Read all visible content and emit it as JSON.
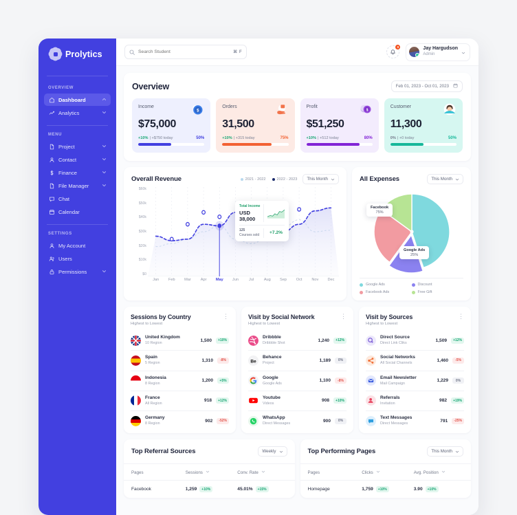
{
  "brand": {
    "name": "Prolytics",
    "logo_icon": "gear-logo-icon",
    "accent": "#4240e0"
  },
  "sidebar": {
    "sections": [
      {
        "label": "OVERVIEW",
        "items": [
          {
            "label": "Dashboard",
            "icon": "home-icon",
            "chevron": "chevron-up-icon",
            "active": true
          },
          {
            "label": "Analytics",
            "icon": "analytics-icon",
            "chevron": "chevron-down-icon",
            "active": false
          }
        ]
      },
      {
        "label": "MENU",
        "items": [
          {
            "label": "Project",
            "icon": "file-icon",
            "chevron": "chevron-down-icon",
            "active": false
          },
          {
            "label": "Contact",
            "icon": "user-icon",
            "chevron": "chevron-down-icon",
            "active": false
          },
          {
            "label": "Finance",
            "icon": "dollar-icon",
            "chevron": "chevron-down-icon",
            "active": false
          },
          {
            "label": "File Manager",
            "icon": "file-icon",
            "chevron": "chevron-down-icon",
            "active": false
          },
          {
            "label": "Chat",
            "icon": "chat-icon",
            "chevron": "",
            "active": false
          },
          {
            "label": "Calendar",
            "icon": "calendar-icon",
            "chevron": "",
            "active": false
          }
        ]
      },
      {
        "label": "SETTINGS",
        "items": [
          {
            "label": "My Account",
            "icon": "user-icon",
            "chevron": "",
            "active": false
          },
          {
            "label": "Users",
            "icon": "users-icon",
            "chevron": "",
            "active": false
          },
          {
            "label": "Permissions",
            "icon": "lock-icon",
            "chevron": "chevron-down-icon",
            "active": false
          }
        ]
      }
    ]
  },
  "topbar": {
    "search_placeholder": "Search Student",
    "search_value": "",
    "search_icon": "search-icon",
    "shortcut": "⌘ F",
    "bell_icon": "bell-icon",
    "notification_count": "0",
    "user_name": "Jay Hargudson",
    "user_role": "Admin",
    "user_chevron": "chevron-down-icon"
  },
  "overview": {
    "title": "Overview",
    "date_range": "Feb 01, 2023 - Oct 01, 2023",
    "calendar_icon": "calendar-icon",
    "kpis": [
      {
        "label": "Income",
        "value": "$75,000",
        "delta": "+10%",
        "sub": "| +$750 today",
        "pct": "50%",
        "fill": 50,
        "bg": "#eef0fe",
        "accent": "#4240e0",
        "delta_color": "#17a673",
        "icon": "coin-dollar-icon"
      },
      {
        "label": "Orders",
        "value": "31,500",
        "delta": "+10%",
        "sub": "| +315 today",
        "pct": "75%",
        "fill": 75,
        "bg": "#fdeae4",
        "accent": "#f26132",
        "delta_color": "#17a673",
        "icon": "hand-package-icon"
      },
      {
        "label": "Profit",
        "value": "$51,250",
        "delta": "+10%",
        "sub": "| +512 today",
        "pct": "80%",
        "fill": 80,
        "bg": "#f3ecfd",
        "accent": "#8224d6",
        "delta_color": "#17a673",
        "icon": "coin-stack-icon"
      },
      {
        "label": "Customer",
        "value": "11,300",
        "delta": "0%",
        "sub": "| +0 today",
        "pct": "50%",
        "fill": 50,
        "bg": "#d6f7f1",
        "accent": "#17b89a",
        "delta_color": "#74798a",
        "icon": "person-avatar-icon"
      }
    ]
  },
  "chart_data": [
    {
      "type": "line",
      "title": "Overall Revenue",
      "xlabel": "",
      "ylabel": "",
      "ylim": [
        0,
        60000
      ],
      "ytick_labels": [
        "$60k",
        "$50k",
        "$40k",
        "$30k",
        "$20k",
        "$10k",
        "$0"
      ],
      "categories": [
        "Jan",
        "Feb",
        "Mar",
        "Apr",
        "May",
        "Jun",
        "Jul",
        "Aug",
        "Sep",
        "Oct",
        "Nov",
        "Dec"
      ],
      "highlight_category": "May",
      "grid": true,
      "legend_position": "top-right",
      "period_selector": "This Month",
      "series": [
        {
          "name": "2021 - 2022",
          "color": "#b8d9ef",
          "values": [
            20000,
            22000,
            25000,
            30000,
            34000,
            25000,
            22000,
            26000,
            33000,
            38000,
            30000,
            31000
          ]
        },
        {
          "name": "2022 - 2023",
          "color": "#4240e0",
          "values": [
            27000,
            24000,
            25000,
            35000,
            34000,
            43000,
            44000,
            38000,
            30000,
            35000,
            44000,
            46000
          ]
        }
      ],
      "markers": [
        {
          "x": "Feb",
          "y": 25000
        },
        {
          "x": "Mar",
          "y": 35000
        },
        {
          "x": "Apr",
          "y": 43000
        },
        {
          "x": "May",
          "y": 40000
        },
        {
          "x": "Sep",
          "y": 44000
        },
        {
          "x": "Oct",
          "y": 45000
        }
      ],
      "tooltip": {
        "caption": "Total Income",
        "value": "USD 38,000",
        "count": "125",
        "count_label": "Courses sold",
        "change": "+7.2%"
      }
    },
    {
      "type": "pie",
      "title": "All Expenses",
      "period_selector": "This Month",
      "labels": [
        "Google Ads",
        "Discount",
        "Facebook Ads",
        "Free Gift"
      ],
      "values": [
        45,
        15,
        25,
        15
      ],
      "colors": [
        "#7fd9de",
        "#8b82f0",
        "#f29ba1",
        "#b7e494"
      ],
      "callouts": [
        {
          "label": "Facebook",
          "value": "75%"
        },
        {
          "label": "Google Ads",
          "value": "25%"
        }
      ],
      "legend_position": "bottom"
    }
  ],
  "panels": [
    {
      "title": "Sessions by Country",
      "subtitle": "Highest to Lowest",
      "menu_icon": "kebab-menu-icon",
      "rows": [
        {
          "name": "United Kingdom",
          "sub": "10 Region",
          "value": "1,500",
          "badge": "+10%",
          "trend": "up",
          "icon": "flag-uk-icon"
        },
        {
          "name": "Spain",
          "sub": "5 Region",
          "value": "1,310",
          "badge": "-8%",
          "trend": "down",
          "icon": "flag-spain-icon"
        },
        {
          "name": "Indonesia",
          "sub": "8 Region",
          "value": "1,200",
          "badge": "+5%",
          "trend": "up",
          "icon": "flag-indonesia-icon"
        },
        {
          "name": "France",
          "sub": "All Region",
          "value": "918",
          "badge": "+12%",
          "trend": "up",
          "icon": "flag-france-icon"
        },
        {
          "name": "Germany",
          "sub": "8 Region",
          "value": "902",
          "badge": "-52%",
          "trend": "down",
          "icon": "flag-germany-icon"
        }
      ]
    },
    {
      "title": "Visit by Social Network",
      "subtitle": "Highest to Lowest",
      "menu_icon": "kebab-menu-icon",
      "rows": [
        {
          "name": "Dribbble",
          "sub": "Dribbble Shot",
          "value": "1,240",
          "badge": "+12%",
          "trend": "up",
          "icon": "dribbble-icon"
        },
        {
          "name": "Behance",
          "sub": "Project",
          "value": "1,189",
          "badge": "0%",
          "trend": "zero",
          "icon": "behance-icon"
        },
        {
          "name": "Google",
          "sub": "Google Ads",
          "value": "1,100",
          "badge": "-8%",
          "trend": "down",
          "icon": "google-icon"
        },
        {
          "name": "Youtube",
          "sub": "Videos",
          "value": "908",
          "badge": "+10%",
          "trend": "up",
          "icon": "youtube-icon"
        },
        {
          "name": "WhatsApp",
          "sub": "Direct Messages",
          "value": "900",
          "badge": "0%",
          "trend": "zero",
          "icon": "whatsapp-icon"
        }
      ]
    },
    {
      "title": "Visit by Sources",
      "subtitle": "Highest to Lowest",
      "menu_icon": "kebab-menu-icon",
      "rows": [
        {
          "name": "Direct Source",
          "sub": "Direct Link Cliks",
          "value": "1,509",
          "badge": "+12%",
          "trend": "up",
          "icon": "cursor-click-icon"
        },
        {
          "name": "Social Networks",
          "sub": "All Social Channels",
          "value": "1,460",
          "badge": "-5%",
          "trend": "down",
          "icon": "share-icon"
        },
        {
          "name": "Email Newsletter",
          "sub": "Mail Campaign",
          "value": "1,229",
          "badge": "0%",
          "trend": "zero",
          "icon": "envelope-icon"
        },
        {
          "name": "Referrals",
          "sub": "Invitation",
          "value": "982",
          "badge": "+19%",
          "trend": "up",
          "icon": "person-add-icon"
        },
        {
          "name": "Text Messages",
          "sub": "Direct Messages",
          "value": "791",
          "badge": "-25%",
          "trend": "down",
          "icon": "message-icon"
        }
      ]
    }
  ],
  "tables": [
    {
      "title": "Top Referral Sources",
      "period_selector": "Weekly",
      "columns": [
        "Pages",
        "Sessions",
        "Conv. Rate"
      ],
      "sortable": [
        false,
        true,
        true
      ],
      "rows": [
        {
          "page": "Facebook",
          "c2_value": "1,259",
          "c2_badge": "+10%",
          "c2_trend": "up",
          "c3_value": "45.01%",
          "c3_badge": "+15%",
          "c3_trend": "up"
        }
      ]
    },
    {
      "title": "Top Performing Pages",
      "period_selector": "This Month",
      "columns": [
        "Pages",
        "Clicks",
        "Avg. Position"
      ],
      "sortable": [
        false,
        true,
        true
      ],
      "rows": [
        {
          "page": "Homepage",
          "c2_value": "1,759",
          "c2_badge": "+10%",
          "c2_trend": "up",
          "c3_value": "3.90",
          "c3_badge": "+10%",
          "c3_trend": "up"
        }
      ]
    }
  ]
}
